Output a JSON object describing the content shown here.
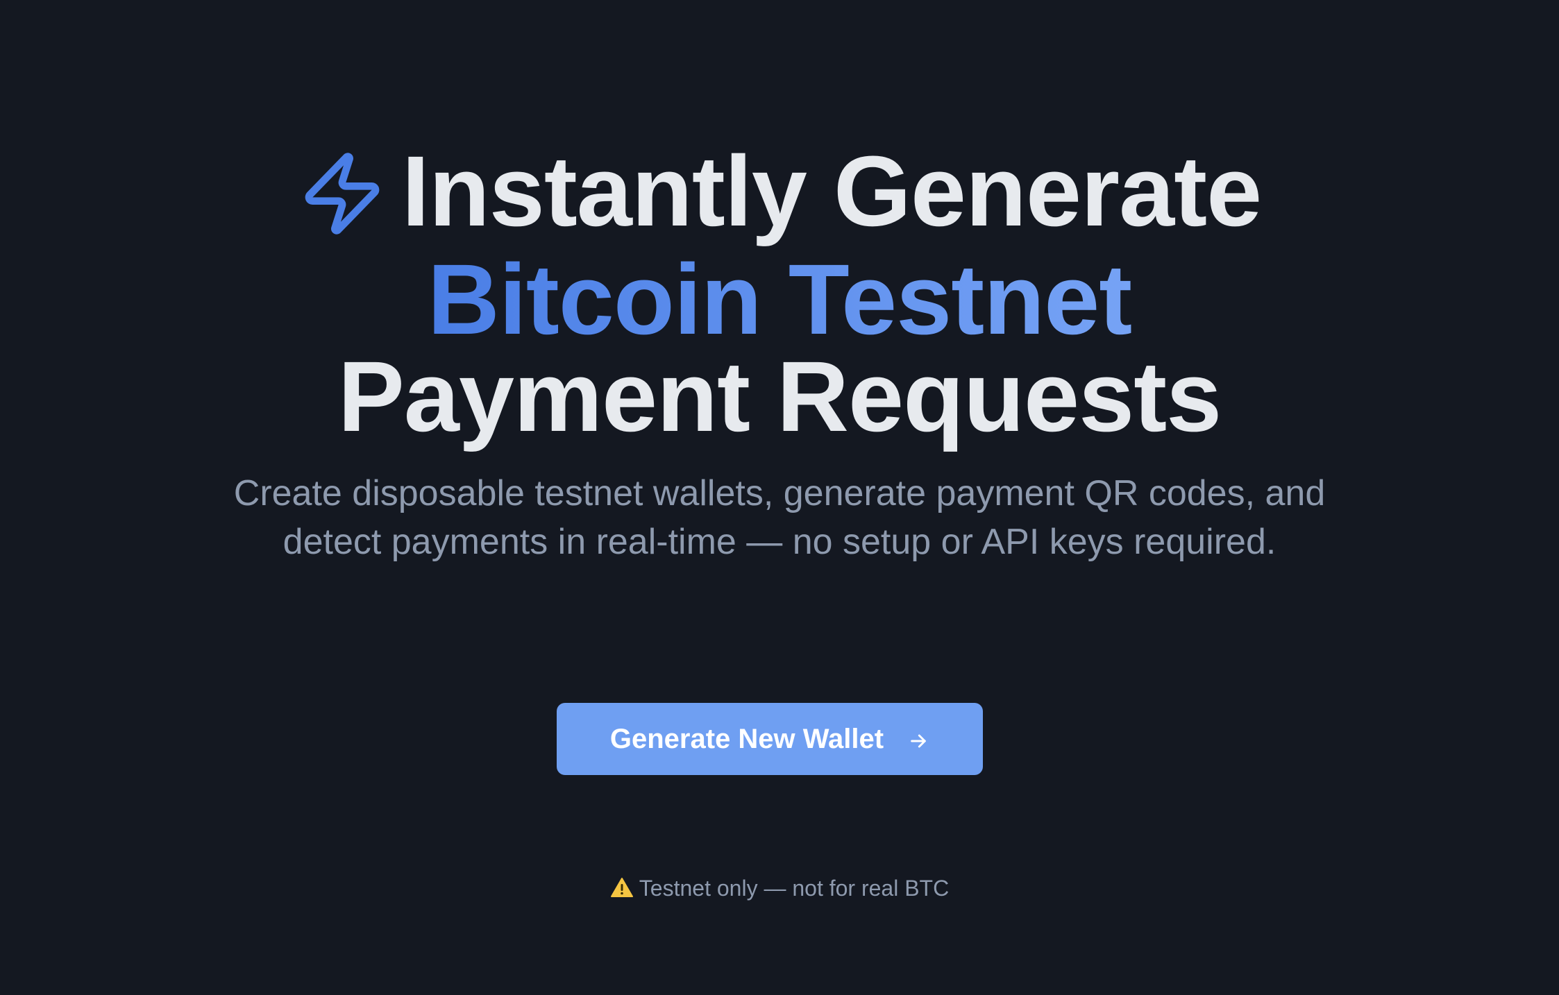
{
  "hero": {
    "headline_line1": "Instantly Generate",
    "headline_line2": "Bitcoin Testnet",
    "headline_line3": "Payment Requests",
    "subtitle": "Create disposable testnet wallets, generate payment QR codes, and detect payments in real-time — no setup or API keys required.",
    "icon": "lightning-bolt-icon"
  },
  "cta": {
    "label": "Generate New Wallet",
    "icon": "arrow-right-icon"
  },
  "footer_note": {
    "text": "Testnet only — not for real BTC",
    "icon": "warning-icon"
  },
  "colors": {
    "background": "#141821",
    "accent": "#5b8ced",
    "button": "#6f9ff2",
    "headline_text": "#e7eaee",
    "muted_text": "#8e9aae",
    "warning": "#f5c542"
  }
}
